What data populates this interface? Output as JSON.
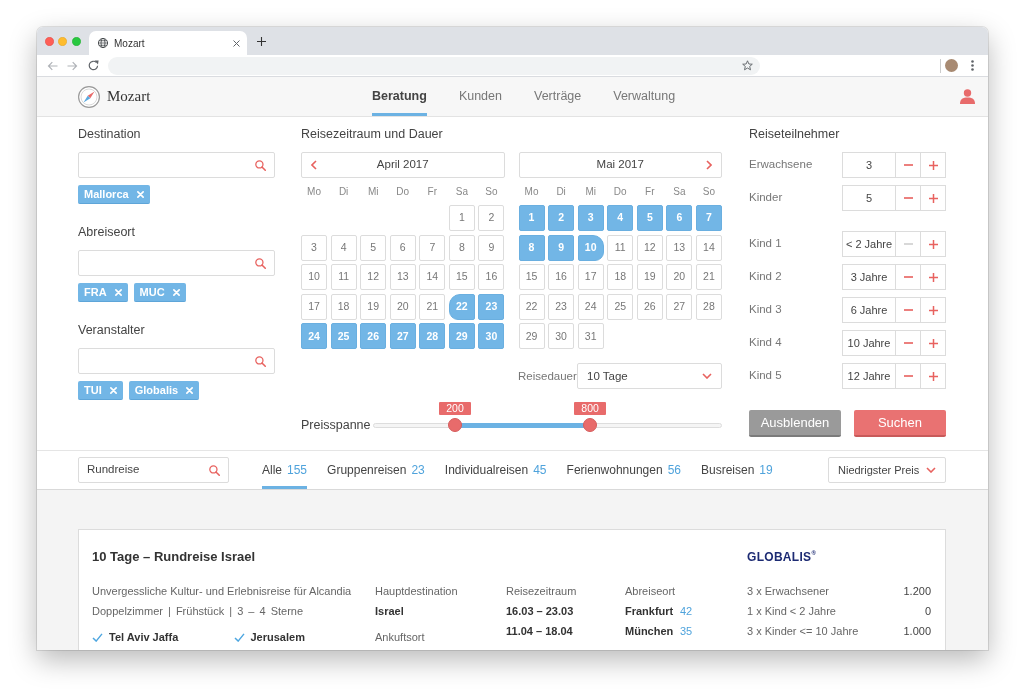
{
  "browser": {
    "tab_title": "Mozart"
  },
  "app": {
    "logo": "Mozart",
    "nav": [
      {
        "label": "Beratung",
        "selected": true
      },
      {
        "label": "Kunden",
        "selected": false
      },
      {
        "label": "Verträge",
        "selected": false
      },
      {
        "label": "Verwaltung",
        "selected": false
      }
    ]
  },
  "search_form": {
    "filters": [
      {
        "label": "Destination",
        "chips": [
          "Mallorca"
        ]
      },
      {
        "label": "Abreiseort",
        "chips": [
          "FRA",
          "MUC"
        ]
      },
      {
        "label": "Veranstalter",
        "chips": [
          "TUI",
          "Globalis"
        ]
      }
    ],
    "travel_period": {
      "title": "Reisezeitraum und Dauer",
      "months": [
        {
          "name": "April 2017",
          "prev_arrow": true,
          "next_arrow": false,
          "weekdays": [
            "Mo",
            "Di",
            "Mi",
            "Do",
            "Fr",
            "Sa",
            "So"
          ],
          "weeks": [
            [
              {
                "day": "1",
                "selected": false
              },
              {
                "day": "2",
                "selected": false
              }
            ],
            [
              {
                "day": "3",
                "selected": false
              },
              {
                "day": "4",
                "selected": false
              },
              {
                "day": "5",
                "selected": false
              },
              {
                "day": "6",
                "selected": false
              },
              {
                "day": "7",
                "selected": false
              },
              {
                "day": "8",
                "selected": false
              },
              {
                "day": "9",
                "selected": false
              }
            ],
            [
              {
                "day": "10",
                "selected": false
              },
              {
                "day": "11",
                "selected": false
              },
              {
                "day": "12",
                "selected": false
              },
              {
                "day": "13",
                "selected": false
              },
              {
                "day": "14",
                "selected": false
              },
              {
                "day": "15",
                "selected": false
              },
              {
                "day": "16",
                "selected": false
              }
            ],
            [
              {
                "day": "17",
                "selected": false
              },
              {
                "day": "18",
                "selected": false
              },
              {
                "day": "19",
                "selected": false
              },
              {
                "day": "20",
                "selected": false
              },
              {
                "day": "21",
                "selected": false
              },
              {
                "day": "22",
                "selected": true
              },
              {
                "day": "23",
                "selected": true
              }
            ],
            [
              {
                "day": "24",
                "selected": true
              },
              {
                "day": "25",
                "selected": true
              },
              {
                "day": "26",
                "selected": true
              },
              {
                "day": "27",
                "selected": true
              },
              {
                "day": "28",
                "selected": true
              },
              {
                "day": "29",
                "selected": true
              },
              {
                "day": "30",
                "selected": true
              }
            ]
          ]
        },
        {
          "name": "Mai 2017",
          "prev_arrow": false,
          "next_arrow": true,
          "weekdays": [
            "Mo",
            "Di",
            "Mi",
            "Do",
            "Fr",
            "Sa",
            "So"
          ],
          "weeks": [
            [
              {
                "day": "1",
                "selected": true
              },
              {
                "day": "2",
                "selected": true
              },
              {
                "day": "3",
                "selected": true
              },
              {
                "day": "4",
                "selected": true
              },
              {
                "day": "5",
                "selected": true
              },
              {
                "day": "6",
                "selected": true
              },
              {
                "day": "7",
                "selected": true
              }
            ],
            [
              {
                "day": "8",
                "selected": true
              },
              {
                "day": "9",
                "selected": true
              },
              {
                "day": "10",
                "selected": true
              },
              {
                "day": "11",
                "selected": false
              },
              {
                "day": "12",
                "selected": false
              },
              {
                "day": "13",
                "selected": false
              },
              {
                "day": "14",
                "selected": false
              }
            ],
            [
              {
                "day": "15",
                "selected": false
              },
              {
                "day": "16",
                "selected": false
              },
              {
                "day": "17",
                "selected": false
              },
              {
                "day": "18",
                "selected": false
              },
              {
                "day": "19",
                "selected": false
              },
              {
                "day": "20",
                "selected": false
              },
              {
                "day": "21",
                "selected": false
              }
            ],
            [
              {
                "day": "22",
                "selected": false
              },
              {
                "day": "23",
                "selected": false
              },
              {
                "day": "24",
                "selected": false
              },
              {
                "day": "25",
                "selected": false
              },
              {
                "day": "26",
                "selected": false
              },
              {
                "day": "27",
                "selected": false
              },
              {
                "day": "28",
                "selected": false
              }
            ],
            [
              {
                "day": "29",
                "selected": false
              },
              {
                "day": "30",
                "selected": false
              },
              {
                "day": "31",
                "selected": false
              }
            ]
          ]
        }
      ],
      "duration": {
        "label": "Reisedauer",
        "value": "10 Tage"
      },
      "price_range": {
        "label": "Preisspanne",
        "thumbs": [
          {
            "label": "200",
            "level": 0.235
          },
          {
            "label": "800",
            "level": 0.622
          }
        ]
      }
    },
    "travelers": {
      "title": "Reiseteilnehmer",
      "counts": [
        {
          "label": "Erwachsene",
          "value": "3",
          "decrement_disabled": false
        },
        {
          "label": "Kinder",
          "value": "5",
          "decrement_disabled": false
        }
      ],
      "children": [
        {
          "label": "Kind 1",
          "value": "< 2 Jahre",
          "decrement_disabled": true
        },
        {
          "label": "Kind 2",
          "value": "3 Jahre",
          "decrement_disabled": false
        },
        {
          "label": "Kind 3",
          "value": "6 Jahre",
          "decrement_disabled": false
        },
        {
          "label": "Kind 4",
          "value": "10 Jahre",
          "decrement_disabled": false
        },
        {
          "label": "Kind 5",
          "value": "12 Jahre",
          "decrement_disabled": false
        }
      ]
    },
    "actions": [
      {
        "label": "Ausblenden",
        "kind": "secondary"
      },
      {
        "label": "Suchen",
        "kind": "primary"
      }
    ]
  },
  "results_bar": {
    "search": {
      "value": "Rundreise"
    },
    "tabs": [
      {
        "label": "Alle",
        "count": "155",
        "selected": true
      },
      {
        "label": "Gruppenreisen",
        "count": "23",
        "selected": false
      },
      {
        "label": "Individualreisen",
        "count": "45",
        "selected": false
      },
      {
        "label": "Ferienwohnungen",
        "count": "56",
        "selected": false
      },
      {
        "label": "Busreisen",
        "count": "19",
        "selected": false
      }
    ],
    "sort": {
      "value": "Niedrigster Preis"
    }
  },
  "results": [
    {
      "title": "10 Tage – Rundreise Israel",
      "operator": "GLOBALIS$^{®}$",
      "description": "Unvergessliche Kultur- und Erlebnisreise für Alcandia",
      "amenities": "Doppelzimmer | Frühstück | 3 – 4 Sterne",
      "highlights": [
        "Tel Aviv Jaffa",
        "Jerusalem"
      ],
      "main_destination": {
        "label": "Hauptdestination",
        "value": "Israel"
      },
      "arrival": {
        "label": "Ankuftsort"
      },
      "periods": {
        "label": "Reisezeitraum",
        "dates": [
          "16.03 – 23.03",
          "11.04 – 18.04"
        ]
      },
      "departures": {
        "label": "Abreiseort",
        "items": [
          {
            "city": "Frankfurt",
            "count": "42"
          },
          {
            "city": "München",
            "count": "35"
          }
        ]
      },
      "prices": [
        {
          "label": "3 x Erwachsener",
          "amount": "1.200"
        },
        {
          "label": "1 x Kind < 2 Jahre",
          "amount": "0"
        },
        {
          "label": "3 x Kinder <= 10 Jahre",
          "amount": "1.000"
        }
      ]
    }
  ]
}
